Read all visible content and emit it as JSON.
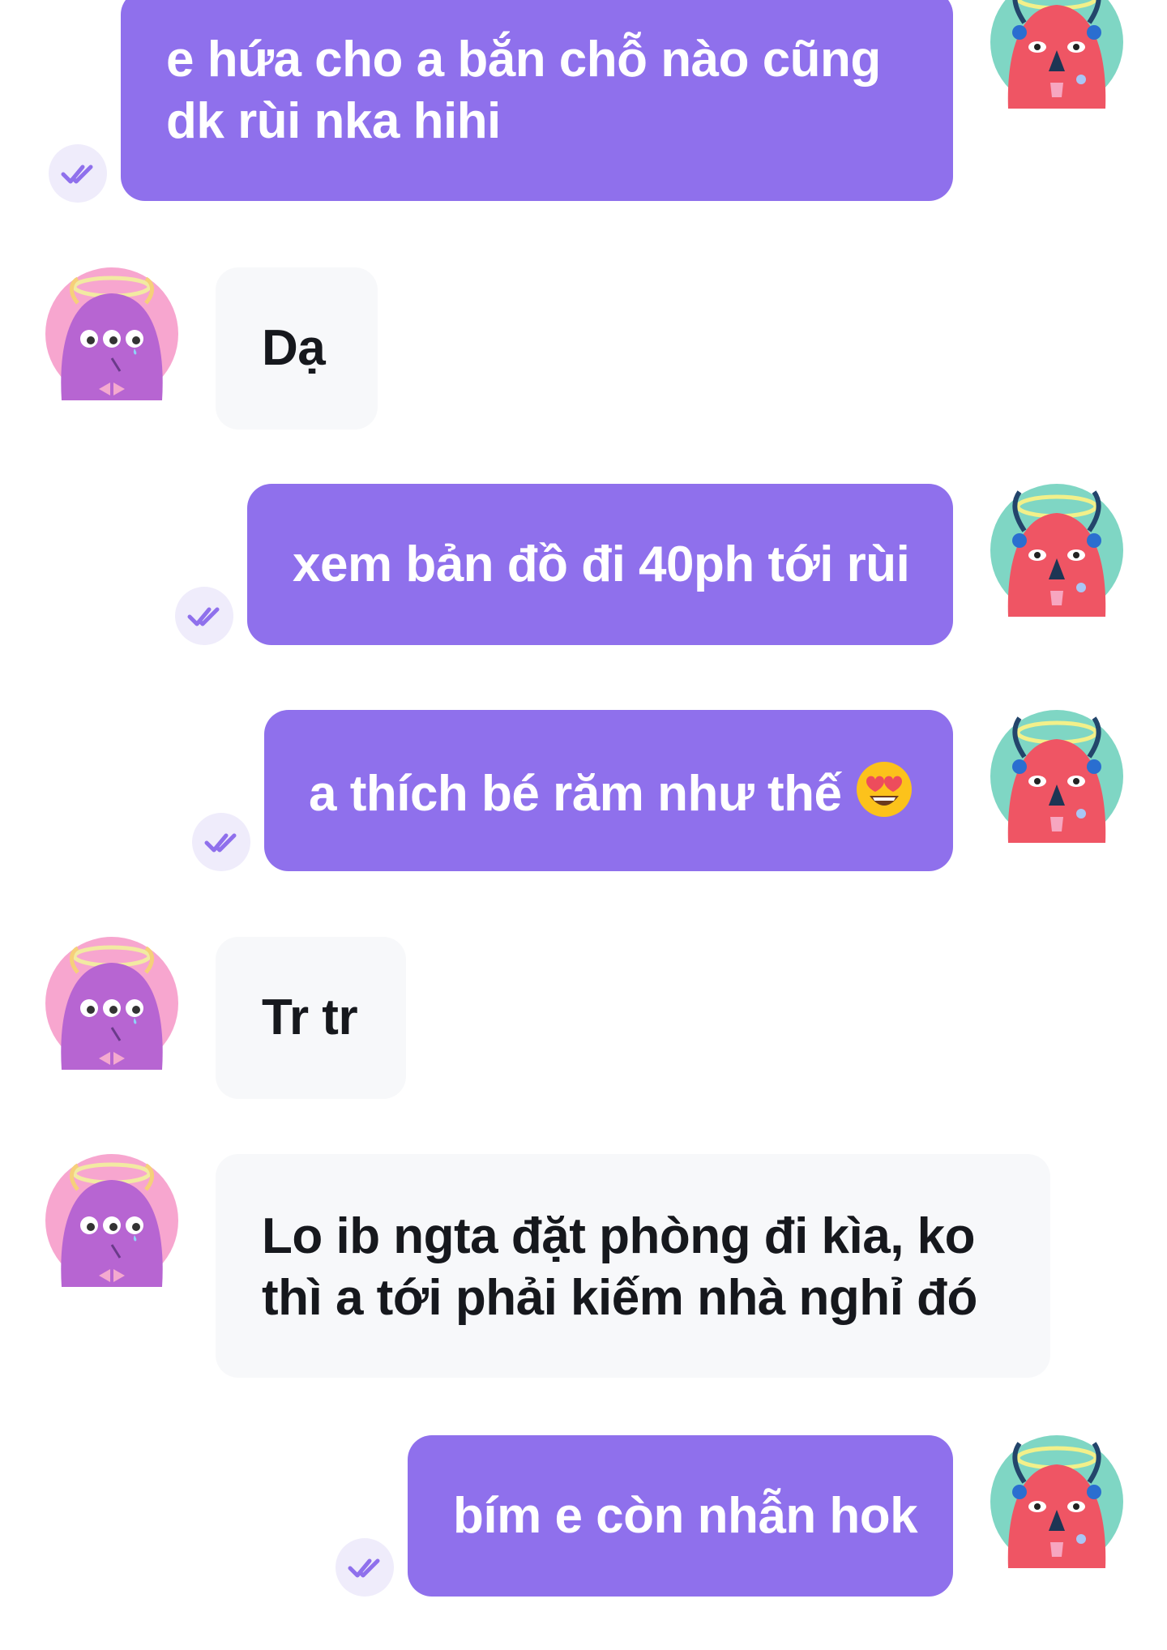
{
  "colors": {
    "outgoing_bubble": "#8f70ec",
    "incoming_bubble": "#f7f8fa",
    "outgoing_text": "#ffffff",
    "incoming_text": "#16181d",
    "read_tick": "#8f70ec",
    "tick_bg": "#efecfb"
  },
  "messages": [
    {
      "direction": "outgoing",
      "lines": [
        "e hứa cho a bắn chỗ nào cũng",
        "dk rùi nka hihi"
      ],
      "status": "read",
      "status_icon": "double-check-icon",
      "avatar": "red-monster-avatar"
    },
    {
      "direction": "incoming",
      "lines": [
        "Dạ"
      ],
      "avatar": "purple-monster-avatar"
    },
    {
      "direction": "outgoing",
      "lines": [
        "xem bản đồ đi 40ph tới rùi"
      ],
      "status": "read",
      "status_icon": "double-check-icon",
      "avatar": "red-monster-avatar"
    },
    {
      "direction": "outgoing",
      "lines": [
        "a thích bé răm như thế"
      ],
      "emoji": "heart-eyes-emoji",
      "status": "read",
      "status_icon": "double-check-icon",
      "avatar": "red-monster-avatar"
    },
    {
      "direction": "incoming",
      "lines": [
        "Tr tr"
      ],
      "avatar": "purple-monster-avatar"
    },
    {
      "direction": "incoming",
      "lines": [
        "Lo ib ngta đặt phòng đi kìa, ko",
        "thì a tới phải kiếm nhà nghỉ đó"
      ],
      "avatar": "purple-monster-avatar"
    },
    {
      "direction": "outgoing",
      "lines": [
        "bím e còn nhẫn hok"
      ],
      "status": "read",
      "status_icon": "double-check-icon",
      "avatar": "red-monster-avatar"
    }
  ]
}
